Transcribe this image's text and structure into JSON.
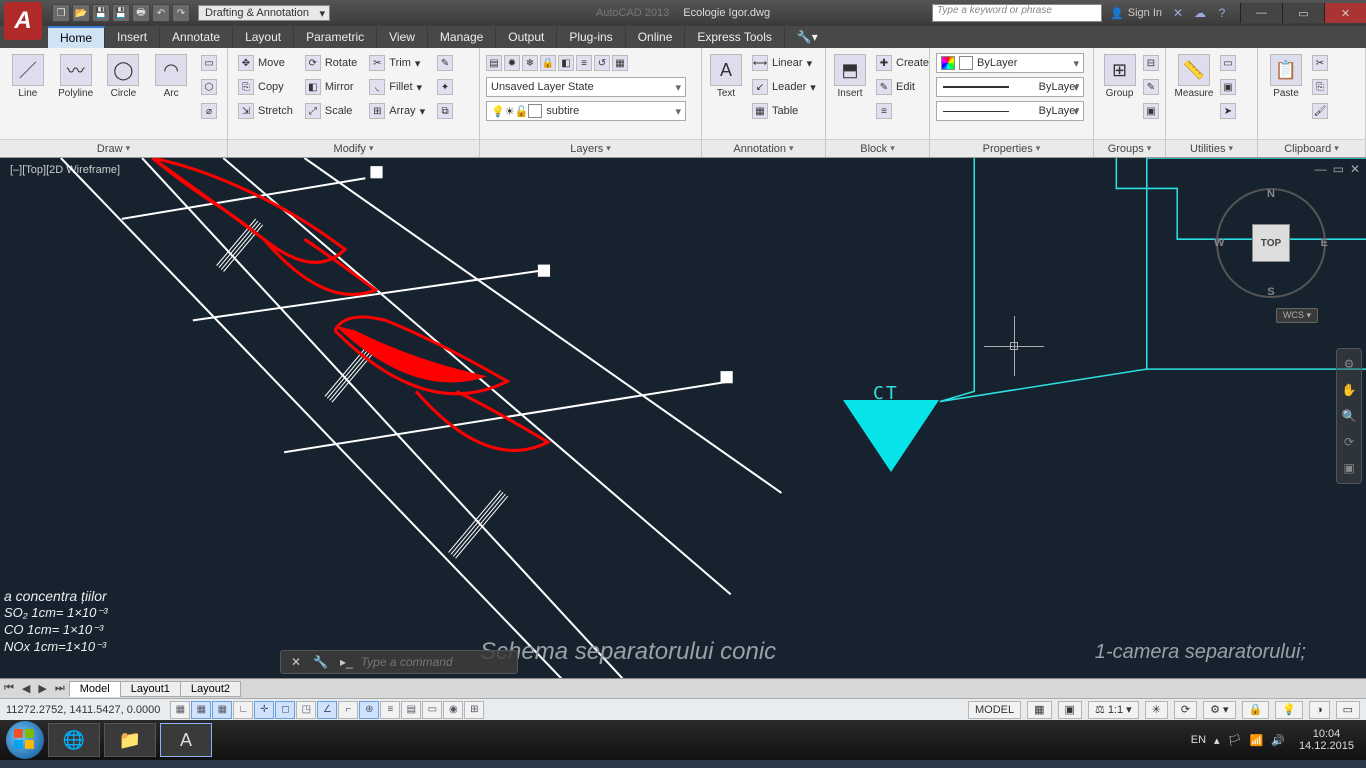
{
  "title": {
    "app": "AutoCAD 2013",
    "file": "Ecologie Igor.dwg"
  },
  "workspace": "Drafting & Annotation",
  "search_placeholder": "Type a keyword or phrase",
  "signin": "Sign In",
  "tabs": [
    "Home",
    "Insert",
    "Annotate",
    "Layout",
    "Parametric",
    "View",
    "Manage",
    "Output",
    "Plug-ins",
    "Online",
    "Express Tools"
  ],
  "active_tab": "Home",
  "ribbon": {
    "draw": {
      "title": "Draw",
      "items": [
        "Line",
        "Polyline",
        "Circle",
        "Arc"
      ]
    },
    "modify": {
      "title": "Modify",
      "col1": [
        "Move",
        "Copy",
        "Stretch"
      ],
      "col2": [
        "Rotate",
        "Mirror",
        "Scale"
      ],
      "col3": [
        "Trim",
        "Fillet",
        "Array"
      ]
    },
    "layers": {
      "title": "Layers",
      "state": "Unsaved Layer State",
      "current": "subtire"
    },
    "annotation": {
      "title": "Annotation",
      "text": "Text",
      "items": [
        "Linear",
        "Leader",
        "Table"
      ]
    },
    "block": {
      "title": "Block",
      "insert": "Insert",
      "items": [
        "Create",
        "Edit"
      ]
    },
    "properties": {
      "title": "Properties",
      "color": "ByLayer",
      "lt": "ByLayer",
      "lw": "ByLayer"
    },
    "groups": {
      "title": "Groups",
      "item": "Group"
    },
    "utilities": {
      "title": "Utilities",
      "item": "Measure"
    },
    "clipboard": {
      "title": "Clipboard",
      "item": "Paste"
    }
  },
  "view_label": "[–][Top][2D Wireframe]",
  "viewcube": {
    "face": "TOP",
    "n": "N",
    "s": "S",
    "e": "E",
    "w": "W",
    "wcs": "WCS ▾"
  },
  "drawing": {
    "ct": "CT",
    "legend_title": "a concentra țiilor",
    "legend_rows": [
      "SO₂  1cm= 1×10⁻³",
      "CO   1cm= 1×10⁻³",
      "NOx 1cm=1×10⁻³"
    ],
    "schema_title": "Schema separatorului conic",
    "schema_sub": "1-camera separatorului;"
  },
  "command_placeholder": "Type a command",
  "layout_tabs": [
    "Model",
    "Layout1",
    "Layout2"
  ],
  "active_layout": "Model",
  "coords": "11272.2752, 1411.5427, 0.0000",
  "status_right": {
    "space": "MODEL",
    "scale": "1:1"
  },
  "taskbar": {
    "lang": "EN",
    "time": "10:04",
    "date": "14.12.2015"
  }
}
